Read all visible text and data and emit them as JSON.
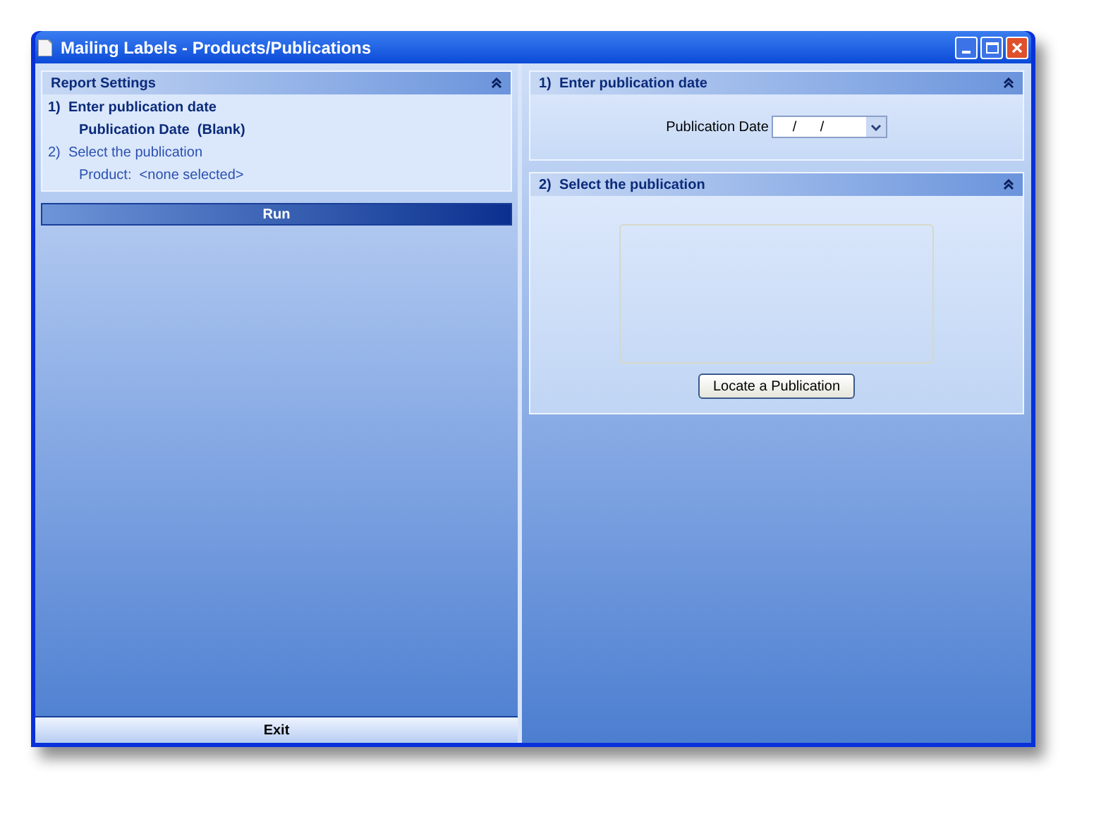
{
  "window": {
    "title": "Mailing Labels - Products/Publications"
  },
  "report_settings": {
    "title": "Report Settings",
    "steps": [
      {
        "label": "1)  Enter publication date",
        "detail": "Publication Date  (Blank)",
        "active": true
      },
      {
        "label": "2)  Select the publication",
        "detail": "Product:  <none selected>",
        "active": false
      }
    ]
  },
  "run_button": "Run",
  "exit_button": "Exit",
  "date_section": {
    "title": "1)  Enter publication date",
    "label": "Publication Date",
    "value": "/      /"
  },
  "publication_section": {
    "title": "2)  Select the publication",
    "button": "Locate a Publication"
  }
}
